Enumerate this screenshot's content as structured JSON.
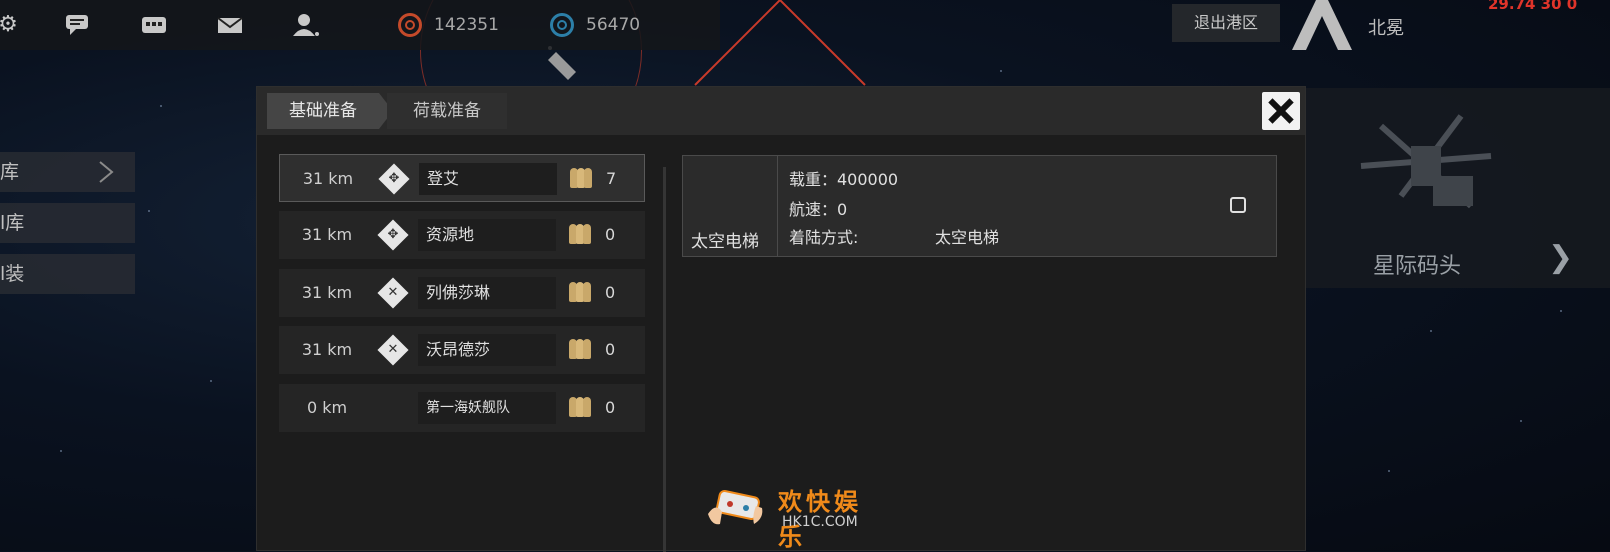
{
  "topbar": {
    "icons": [
      "gear-icon",
      "chat-icon",
      "message-icon",
      "mail-icon",
      "user-icon"
    ],
    "credits": "142351",
    "energy": "56470"
  },
  "header_right": {
    "exit_port_label": "退出港区",
    "region_name": "北冕",
    "coords": "29.74 30 0"
  },
  "sidebar": {
    "items": [
      {
        "label": "库"
      },
      {
        "label": "l库"
      },
      {
        "label": "l装"
      }
    ]
  },
  "right_panel": {
    "label": "星际码头"
  },
  "modal": {
    "tabs": [
      {
        "label": "基础准备"
      },
      {
        "label": "荷载准备"
      }
    ],
    "destinations": [
      {
        "distance": "31 km",
        "name": "登艾",
        "crew": "7",
        "selected": true
      },
      {
        "distance": "31 km",
        "name": "资源地",
        "crew": "0",
        "selected": false
      },
      {
        "distance": "31 km",
        "name": "列佛莎琳",
        "crew": "0",
        "selected": false
      },
      {
        "distance": "31 km",
        "name": "沃昂德莎",
        "crew": "0",
        "selected": false
      },
      {
        "distance": "0 km",
        "name": "第一海妖舰队",
        "crew": "0",
        "selected": false
      }
    ],
    "detail": {
      "title": "太空电梯",
      "load": "载重：400000",
      "speed": "航速：0",
      "landing_label": "着陆方式:",
      "landing_value": "太空电梯",
      "checked": false
    }
  },
  "watermark": {
    "text": "欢快娱乐",
    "url": "HK1C.COM"
  }
}
